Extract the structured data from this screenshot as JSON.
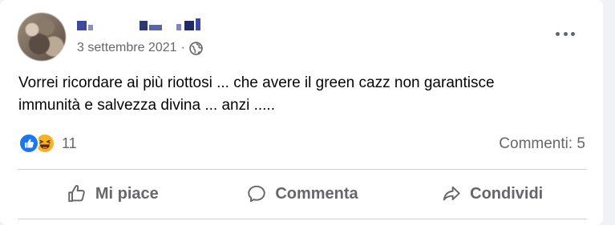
{
  "post": {
    "date": "3 settembre 2021",
    "separator": "·",
    "text_line1": "Vorrei ricordare ai più riottosi ... che avere il green cazz non garantisce",
    "text_line2": "immunità e salvezza divina ... anzi .....",
    "audience_icon": "globe-icon"
  },
  "engagement": {
    "reaction_count": "11",
    "reaction_icons": [
      "like-reaction-icon",
      "haha-reaction-icon"
    ],
    "comments_label": "Commenti: 5"
  },
  "actions": {
    "like": "Mi piace",
    "comment": "Commenta",
    "share": "Condividi"
  },
  "colors": {
    "like_blue": "#1877f2",
    "haha_yellow": "#f7b125",
    "secondary_text": "#65676b"
  }
}
